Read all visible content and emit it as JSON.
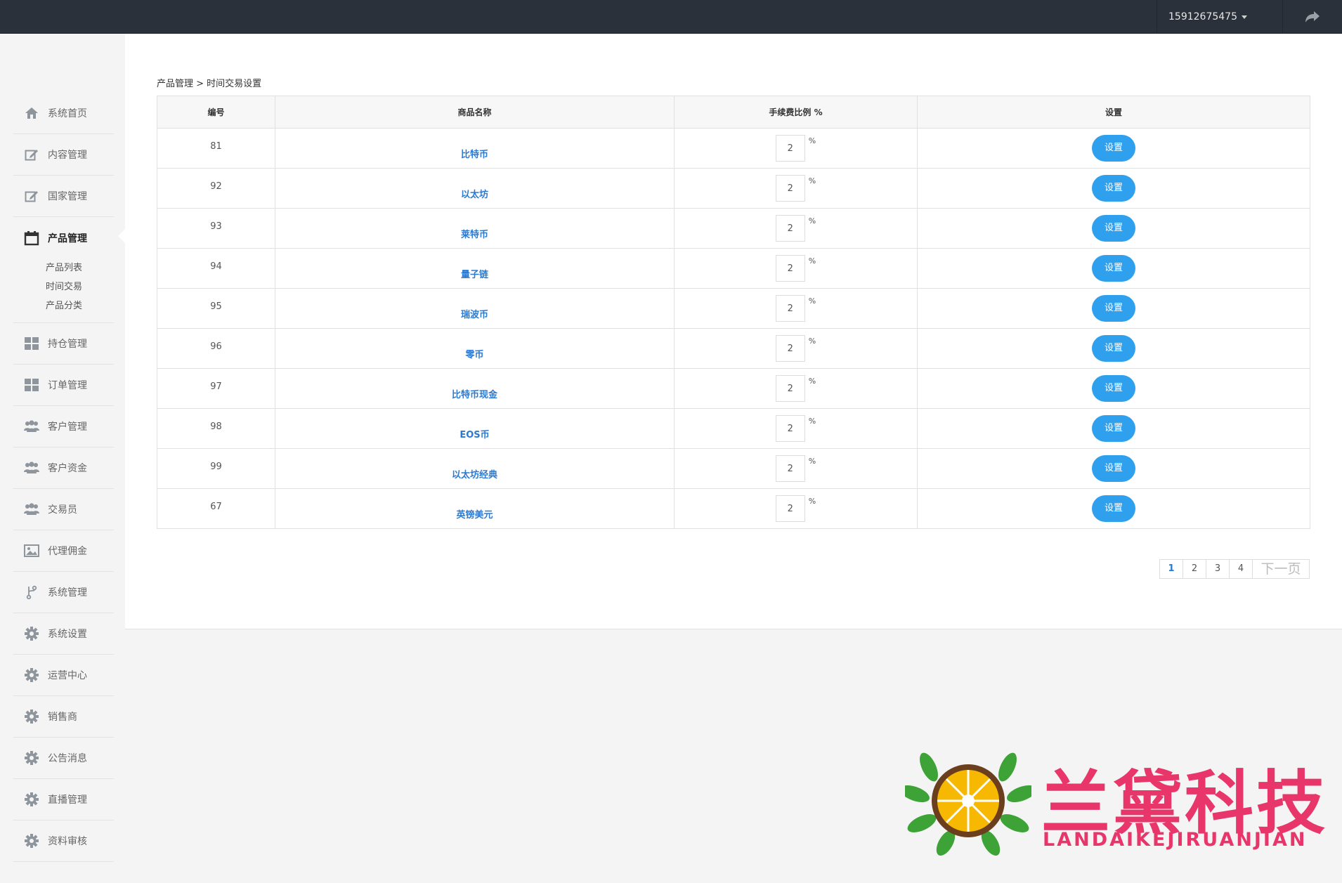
{
  "topbar": {
    "username": "15912675475"
  },
  "sidebar": {
    "items": [
      {
        "label": "系统首页",
        "icon": "home-icon"
      },
      {
        "label": "内容管理",
        "icon": "edit-icon"
      },
      {
        "label": "国家管理",
        "icon": "edit-icon"
      },
      {
        "label": "产品管理",
        "icon": "calendar-icon"
      },
      {
        "label": "持仓管理",
        "icon": "grid-icon"
      },
      {
        "label": "订单管理",
        "icon": "grid-icon"
      },
      {
        "label": "客户管理",
        "icon": "users-icon"
      },
      {
        "label": "客户资金",
        "icon": "users-icon"
      },
      {
        "label": "交易员",
        "icon": "users-icon"
      },
      {
        "label": "代理佣金",
        "icon": "image-icon"
      },
      {
        "label": "系统管理",
        "icon": "branch-icon"
      },
      {
        "label": "系统设置",
        "icon": "gear-icon"
      },
      {
        "label": "运营中心",
        "icon": "gear-icon"
      },
      {
        "label": "销售商",
        "icon": "gear-icon"
      },
      {
        "label": "公告消息",
        "icon": "gear-icon"
      },
      {
        "label": "直播管理",
        "icon": "gear-icon"
      },
      {
        "label": "资料审核",
        "icon": "gear-icon"
      }
    ],
    "sub_items": [
      "产品列表",
      "时间交易",
      "产品分类"
    ]
  },
  "breadcrumb": "产品管理 > 时间交易设置",
  "table": {
    "headers": [
      "编号",
      "商品名称",
      "手续费比例 %",
      "设置"
    ],
    "pct_symbol": "%",
    "button_label": "设置",
    "rows": [
      {
        "id": "81",
        "name": "比特币",
        "fee": "2"
      },
      {
        "id": "92",
        "name": "以太坊",
        "fee": "2"
      },
      {
        "id": "93",
        "name": "莱特币",
        "fee": "2"
      },
      {
        "id": "94",
        "name": "量子链",
        "fee": "2"
      },
      {
        "id": "95",
        "name": "瑞波币",
        "fee": "2"
      },
      {
        "id": "96",
        "name": "零币",
        "fee": "2"
      },
      {
        "id": "97",
        "name": "比特币现金",
        "fee": "2"
      },
      {
        "id": "98",
        "name": "EOS币",
        "fee": "2"
      },
      {
        "id": "99",
        "name": "以太坊经典",
        "fee": "2"
      },
      {
        "id": "67",
        "name": "英镑美元",
        "fee": "2"
      }
    ]
  },
  "pagination": {
    "pages": [
      "1",
      "2",
      "3",
      "4"
    ],
    "current": "1",
    "next_label": "下一页"
  },
  "watermark": {
    "title": "兰黛科技",
    "subtitle": "LANDAIKEJIRUANJIAN"
  },
  "colors": {
    "topbar": "#2b313a",
    "link": "#2a7ad3",
    "button": "#2ea0ee",
    "watermark": "#e8366b"
  }
}
